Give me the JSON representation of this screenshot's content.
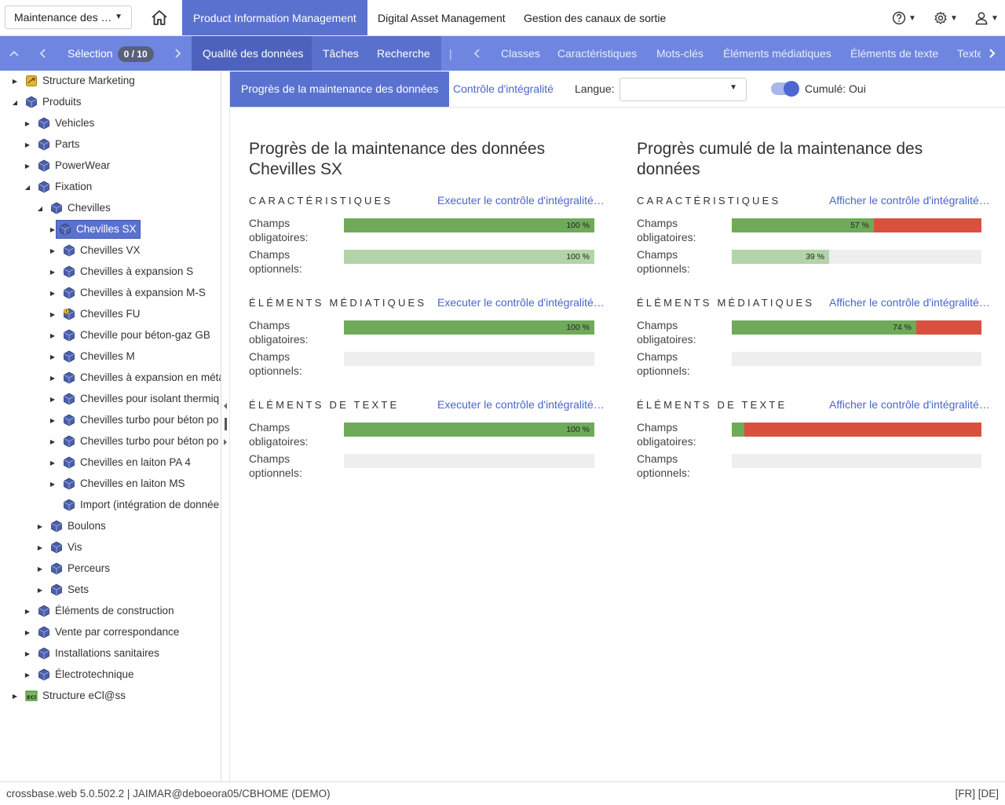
{
  "topbar": {
    "module_select": "Maintenance des …",
    "tabs": [
      {
        "label": "Product Information Management",
        "active": true
      },
      {
        "label": "Digital Asset Management",
        "active": false
      },
      {
        "label": "Gestion des canaux de sortie",
        "active": false
      }
    ],
    "icons": [
      "help-icon",
      "settings-icon",
      "user-icon"
    ]
  },
  "navbar": {
    "selection_label": "Sélection",
    "selection_count": "0 / 10",
    "tabs": [
      {
        "label": "Qualité des données",
        "active": true
      },
      {
        "label": "Tâches",
        "active": false
      },
      {
        "label": "Recherche",
        "active": false
      }
    ],
    "separator": "|",
    "classes_tabs": [
      "Classes",
      "Caractéristiques",
      "Mots-clés",
      "Éléments médiatiques",
      "Éléments de texte",
      "Texte"
    ]
  },
  "tree": [
    {
      "label": "Structure Marketing",
      "icon": "marketing-structure-icon",
      "level": 0,
      "toggle": "collapsed"
    },
    {
      "label": "Produits",
      "icon": "cube-icon",
      "level": 0,
      "toggle": "expanded"
    },
    {
      "label": "Vehicles",
      "icon": "cube-icon",
      "level": 1,
      "toggle": "collapsed"
    },
    {
      "label": "Parts",
      "icon": "cube-icon",
      "level": 1,
      "toggle": "collapsed"
    },
    {
      "label": "PowerWear",
      "icon": "cube-icon",
      "level": 1,
      "toggle": "collapsed"
    },
    {
      "label": "Fixation",
      "icon": "cube-icon",
      "level": 1,
      "toggle": "expanded"
    },
    {
      "label": "Chevilles",
      "icon": "cube-icon",
      "level": 2,
      "toggle": "expanded"
    },
    {
      "label": "Chevilles SX",
      "icon": "cube-icon",
      "level": 3,
      "toggle": "collapsed",
      "selected": true
    },
    {
      "label": "Chevilles VX",
      "icon": "cube-icon",
      "level": 3,
      "toggle": "collapsed"
    },
    {
      "label": "Chevilles à expansion S",
      "icon": "cube-icon",
      "level": 3,
      "toggle": "collapsed"
    },
    {
      "label": "Chevilles à expansion M-S",
      "icon": "cube-icon",
      "level": 3,
      "toggle": "collapsed"
    },
    {
      "label": "Chevilles FU",
      "icon": "cube-warning-icon",
      "level": 3,
      "toggle": "collapsed"
    },
    {
      "label": "Cheville pour béton-gaz GB",
      "icon": "cube-icon",
      "level": 3,
      "toggle": "collapsed"
    },
    {
      "label": "Chevilles M",
      "icon": "cube-icon",
      "level": 3,
      "toggle": "collapsed"
    },
    {
      "label": "Chevilles à expansion en méta",
      "icon": "cube-icon",
      "level": 3,
      "toggle": "collapsed"
    },
    {
      "label": "Chevilles pour isolant thermiq",
      "icon": "cube-icon",
      "level": 3,
      "toggle": "collapsed"
    },
    {
      "label": "Chevilles turbo pour béton po",
      "icon": "cube-icon",
      "level": 3,
      "toggle": "collapsed"
    },
    {
      "label": "Chevilles turbo pour béton po",
      "icon": "cube-icon",
      "level": 3,
      "toggle": "collapsed"
    },
    {
      "label": "Chevilles en laiton PA 4",
      "icon": "cube-icon",
      "level": 3,
      "toggle": "collapsed"
    },
    {
      "label": "Chevilles en laiton MS",
      "icon": "cube-icon",
      "level": 3,
      "toggle": "collapsed"
    },
    {
      "label": "Import (intégration de donnée",
      "icon": "cube-icon",
      "level": 3,
      "toggle": "none"
    },
    {
      "label": "Boulons",
      "icon": "cube-icon",
      "level": 2,
      "toggle": "collapsed"
    },
    {
      "label": "Vis",
      "icon": "cube-icon",
      "level": 2,
      "toggle": "collapsed"
    },
    {
      "label": "Perceurs",
      "icon": "cube-icon",
      "level": 2,
      "toggle": "collapsed"
    },
    {
      "label": "Sets",
      "icon": "cube-icon",
      "level": 2,
      "toggle": "collapsed"
    },
    {
      "label": "Éléments de construction",
      "icon": "cube-icon",
      "level": 1,
      "toggle": "collapsed"
    },
    {
      "label": "Vente par correspondance",
      "icon": "cube-icon",
      "level": 1,
      "toggle": "collapsed"
    },
    {
      "label": "Installations sanitaires",
      "icon": "cube-icon",
      "level": 1,
      "toggle": "collapsed"
    },
    {
      "label": "Électrotechnique",
      "icon": "cube-icon",
      "level": 1,
      "toggle": "collapsed"
    },
    {
      "label": "Structure eCl@ss",
      "icon": "eclass-icon",
      "level": 0,
      "toggle": "collapsed"
    }
  ],
  "subbar": {
    "tabs": [
      {
        "label": "Progrès de la maintenance des données",
        "active": true
      },
      {
        "label": "Contrôle d'intégralité",
        "active": false
      }
    ],
    "lang_label": "Langue:",
    "lang_value": "",
    "cumul_label": "Cumulé: Oui",
    "cumul_on": true
  },
  "colors": {
    "green": "#6faa5a",
    "light_green": "#b3d4a8",
    "red": "#d9503f",
    "empty": "#eeeeee",
    "accent": "#5a72cf"
  },
  "panels": [
    {
      "title_line1": "Progrès de la maintenance des données",
      "title_line2": "Chevilles SX",
      "sections": [
        {
          "heading": "CARACTÉRISTIQUES",
          "link": "Executer le contrôle d'intégralité…",
          "rows": [
            {
              "label1": "Champs",
              "label2": "obligatoires:",
              "percent": 100,
              "text": "100 %",
              "kind": "green"
            },
            {
              "label1": "Champs",
              "label2": "optionnels:",
              "percent": 100,
              "text": "100 %",
              "kind": "light"
            }
          ]
        },
        {
          "heading": "ÉLÉMENTS MÉDIATIQUES",
          "link": "Executer le contrôle d'intégralité…",
          "rows": [
            {
              "label1": "Champs",
              "label2": "obligatoires:",
              "percent": 100,
              "text": "100 %",
              "kind": "green"
            },
            {
              "label1": "Champs",
              "label2": "optionnels:",
              "percent": 0,
              "text": "",
              "kind": "empty"
            }
          ]
        },
        {
          "heading": "ÉLÉMENTS DE TEXTE",
          "link": "Executer le contrôle d'intégralité…",
          "rows": [
            {
              "label1": "Champs",
              "label2": "obligatoires:",
              "percent": 100,
              "text": "100 %",
              "kind": "green"
            },
            {
              "label1": "Champs",
              "label2": "optionnels:",
              "percent": 0,
              "text": "",
              "kind": "empty"
            }
          ]
        }
      ]
    },
    {
      "title_line1": "Progrès cumulé de la maintenance des",
      "title_line2": "données",
      "sections": [
        {
          "heading": "CARACTÉRISTIQUES",
          "link": "Afficher le contrôle d'intégralité…",
          "rows": [
            {
              "label1": "Champs",
              "label2": "obligatoires:",
              "percent": 57,
              "text": "57 %",
              "kind": "green-red"
            },
            {
              "label1": "Champs",
              "label2": "optionnels:",
              "percent": 39,
              "text": "39 %",
              "kind": "light"
            }
          ]
        },
        {
          "heading": "ÉLÉMENTS MÉDIATIQUES",
          "link": "Afficher le contrôle d'intégralité…",
          "rows": [
            {
              "label1": "Champs",
              "label2": "obligatoires:",
              "percent": 74,
              "text": "74 %",
              "kind": "green-red"
            },
            {
              "label1": "Champs",
              "label2": "optionnels:",
              "percent": 0,
              "text": "",
              "kind": "empty"
            }
          ]
        },
        {
          "heading": "ÉLÉMENTS DE TEXTE",
          "link": "Afficher le contrôle d'intégralité…",
          "rows": [
            {
              "label1": "Champs",
              "label2": "obligatoires:",
              "percent": 5,
              "text": "",
              "kind": "green-red"
            },
            {
              "label1": "Champs",
              "label2": "optionnels:",
              "percent": 0,
              "text": "",
              "kind": "empty"
            }
          ]
        }
      ]
    }
  ],
  "footer": {
    "left": "crossbase.web 5.0.502.2 | JAIMAR@deboeora05/CBHOME (DEMO)",
    "right": "[FR] [DE]"
  }
}
